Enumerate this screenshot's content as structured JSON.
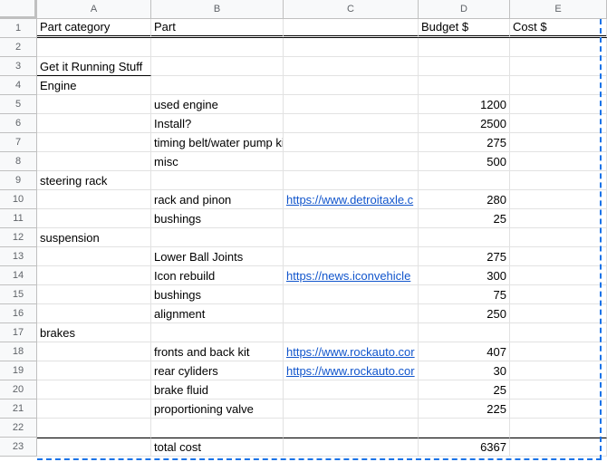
{
  "columns": [
    "A",
    "B",
    "C",
    "D",
    "E"
  ],
  "rows": [
    "1",
    "2",
    "3",
    "4",
    "5",
    "6",
    "7",
    "8",
    "9",
    "10",
    "11",
    "12",
    "13",
    "14",
    "15",
    "16",
    "17",
    "18",
    "19",
    "20",
    "21",
    "22",
    "23"
  ],
  "cells": {
    "r1": {
      "a": "Part category",
      "b": "Part",
      "c": "",
      "d": "Budget $",
      "e": "Cost $"
    },
    "r2": {
      "a": "",
      "b": "",
      "c": "",
      "d": "",
      "e": ""
    },
    "r3": {
      "a": "Get it Running Stuff",
      "b": "",
      "c": "",
      "d": "",
      "e": ""
    },
    "r4": {
      "a": "Engine",
      "b": "",
      "c": "",
      "d": "",
      "e": ""
    },
    "r5": {
      "a": "",
      "b": "used engine",
      "c": "",
      "d": "1200",
      "e": ""
    },
    "r6": {
      "a": "",
      "b": "Install?",
      "c": "",
      "d": "2500",
      "e": ""
    },
    "r7": {
      "a": "",
      "b": "timing belt/water pump kit",
      "c": "",
      "d": "275",
      "e": ""
    },
    "r8": {
      "a": "",
      "b": "misc",
      "c": "",
      "d": "500",
      "e": ""
    },
    "r9": {
      "a": "steering rack",
      "b": "",
      "c": "",
      "d": "",
      "e": ""
    },
    "r10": {
      "a": "",
      "b": "rack and pinon",
      "c": "https://www.detroitaxle.c",
      "d": "280",
      "e": ""
    },
    "r11": {
      "a": "",
      "b": "bushings",
      "c": "",
      "d": "25",
      "e": ""
    },
    "r12": {
      "a": "suspension",
      "b": "",
      "c": "",
      "d": "",
      "e": ""
    },
    "r13": {
      "a": "",
      "b": "Lower Ball Joints",
      "c": "",
      "d": "275",
      "e": ""
    },
    "r14": {
      "a": "",
      "b": "Icon rebuild",
      "c": "https://news.iconvehicle",
      "d": "300",
      "e": ""
    },
    "r15": {
      "a": "",
      "b": "bushings",
      "c": "",
      "d": "75",
      "e": ""
    },
    "r16": {
      "a": "",
      "b": "alignment",
      "c": "",
      "d": "250",
      "e": ""
    },
    "r17": {
      "a": "brakes",
      "b": "",
      "c": "",
      "d": "",
      "e": ""
    },
    "r18": {
      "a": "",
      "b": "fronts and back kit",
      "c": "https://www.rockauto.cor",
      "d": "407",
      "e": ""
    },
    "r19": {
      "a": "",
      "b": "rear cyliders",
      "c": "https://www.rockauto.cor",
      "d": "30",
      "e": ""
    },
    "r20": {
      "a": "",
      "b": "brake fluid",
      "c": "",
      "d": "25",
      "e": ""
    },
    "r21": {
      "a": "",
      "b": "proportioning valve",
      "c": "",
      "d": "225",
      "e": ""
    },
    "r22": {
      "a": "",
      "b": "",
      "c": "",
      "d": "",
      "e": ""
    },
    "r23": {
      "a": "",
      "b": "total cost",
      "c": "",
      "d": "6367",
      "e": ""
    }
  },
  "colors": {
    "link": "#1155cc",
    "selection": "#1a73e8",
    "header_bg": "#f8f9fa"
  }
}
